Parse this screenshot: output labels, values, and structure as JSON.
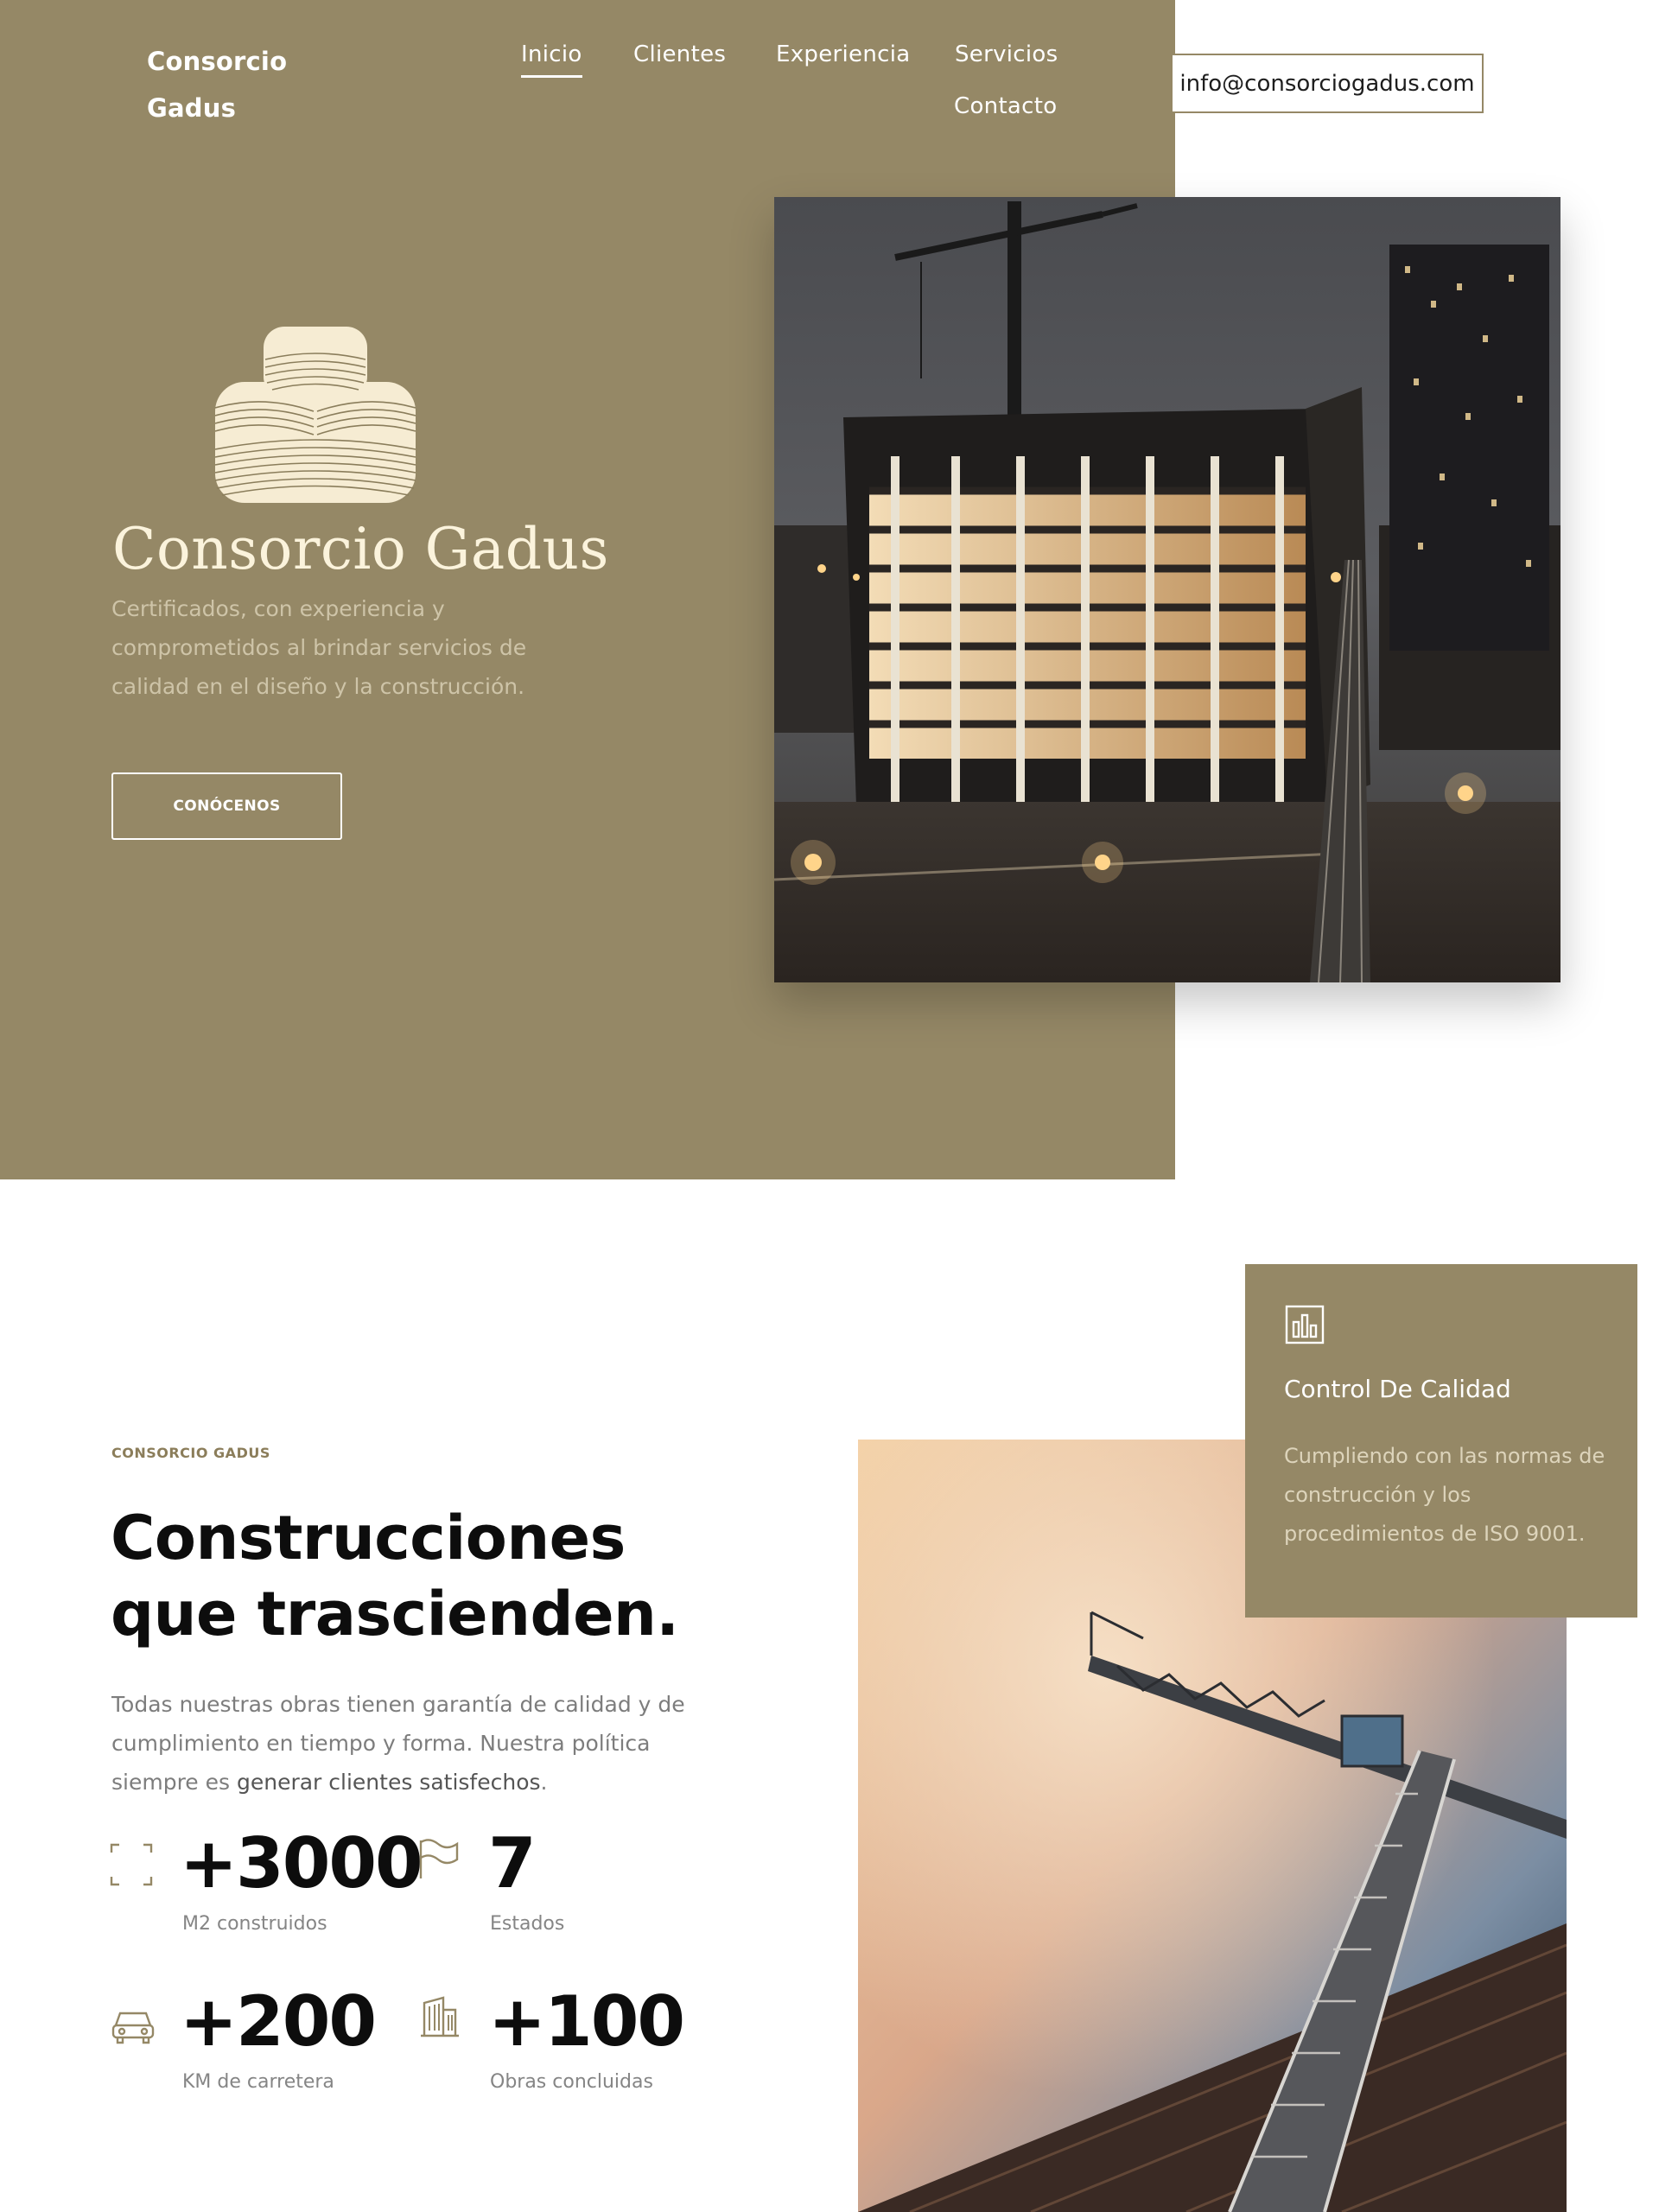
{
  "colors": {
    "brand": "#958866",
    "hero_title": "#fbf3dc",
    "hero_text": "#cec4a8",
    "eyebrow": "#8b7d5a",
    "heading": "#0d0d0d",
    "body_text": "#7d7d7d"
  },
  "header": {
    "brand_line1": "Consorcio",
    "brand_line2": "Gadus",
    "nav": {
      "inicio": "Inicio",
      "clientes": "Clientes",
      "experiencia": "Experiencia",
      "servicios": "Servicios",
      "contacto": "Contacto"
    },
    "active_nav": "Inicio",
    "email": "info@consorciogadus.com"
  },
  "hero": {
    "logo_icon": "stacked-layers-logo",
    "title": "Consorcio Gadus",
    "description": "Certificados, con experiencia y comprometidos al brindar servicios de calidad en el diseño y la construcción.",
    "cta": "CONÓCENOS",
    "image": "night-construction-site-photo"
  },
  "about": {
    "eyebrow": "CONSORCIO GADUS",
    "title": "Construcciones que trascienden.",
    "description_start": "Todas nuestras obras tienen garantía de calidad y de cumplimiento en tiempo y forma. Nuestra política siempre es ",
    "description_highlight": "generar clientes satisfechos",
    "description_end": ".",
    "image": "tower-crane-photo",
    "stats": [
      {
        "icon": "expand-icon",
        "value": "+3000",
        "label": "M2 construidos"
      },
      {
        "icon": "flag-icon",
        "value": "7",
        "label": "Estados"
      },
      {
        "icon": "car-icon",
        "value": "+200",
        "label": "KM de carretera"
      },
      {
        "icon": "building-icon",
        "value": "+100",
        "label": "Obras concluidas"
      }
    ]
  },
  "quality_card": {
    "icon": "bar-chart-icon",
    "title": "Control De Calidad",
    "text": "Cumpliendo con las normas de construcción y los procedimientos de ISO 9001."
  }
}
